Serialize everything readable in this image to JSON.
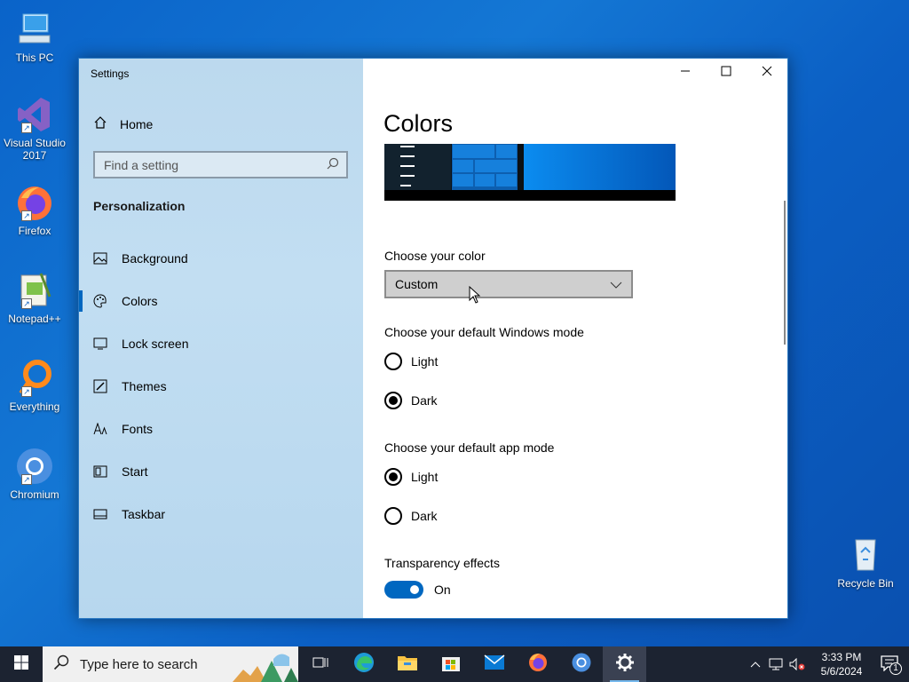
{
  "desktop": {
    "icons": [
      {
        "label": "This PC",
        "icon": "computer-icon"
      },
      {
        "label": "Visual Studio 2017",
        "icon": "visual-studio-icon"
      },
      {
        "label": "Firefox",
        "icon": "firefox-icon"
      },
      {
        "label": "Notepad++",
        "icon": "notepadpp-icon"
      },
      {
        "label": "Everything",
        "icon": "search-magnifier-icon"
      },
      {
        "label": "Chromium",
        "icon": "chromium-icon"
      }
    ],
    "recycle_bin": "Recycle Bin"
  },
  "window": {
    "title": "Settings",
    "controls": {
      "minimize": "minimize-icon",
      "maximize": "maximize-icon",
      "close": "close-icon"
    }
  },
  "sidebar": {
    "home_label": "Home",
    "search_placeholder": "Find a setting",
    "section_label": "Personalization",
    "items": [
      {
        "label": "Background",
        "icon": "image-icon"
      },
      {
        "label": "Colors",
        "icon": "palette-icon",
        "active": true
      },
      {
        "label": "Lock screen",
        "icon": "monitor-icon"
      },
      {
        "label": "Themes",
        "icon": "brush-icon"
      },
      {
        "label": "Fonts",
        "icon": "font-icon"
      },
      {
        "label": "Start",
        "icon": "start-icon"
      },
      {
        "label": "Taskbar",
        "icon": "taskbar-icon"
      }
    ]
  },
  "main": {
    "title": "Colors",
    "choose_color_label": "Choose your color",
    "choose_color_value": "Custom",
    "windows_mode_label": "Choose your default Windows mode",
    "windows_mode_options": [
      {
        "label": "Light",
        "selected": false
      },
      {
        "label": "Dark",
        "selected": true
      }
    ],
    "app_mode_label": "Choose your default app mode",
    "app_mode_options": [
      {
        "label": "Light",
        "selected": true
      },
      {
        "label": "Dark",
        "selected": false
      }
    ],
    "transparency_label": "Transparency effects",
    "transparency_state": "On",
    "accent_color": "#0067c0"
  },
  "taskbar": {
    "search_placeholder": "Type here to search",
    "pinned": [
      "task-view-icon",
      "edge-icon",
      "file-explorer-icon",
      "store-icon",
      "mail-icon",
      "firefox-icon",
      "chromium-icon",
      "settings-icon"
    ],
    "time": "3:33 PM",
    "date": "5/6/2024",
    "notification_count": "1"
  }
}
